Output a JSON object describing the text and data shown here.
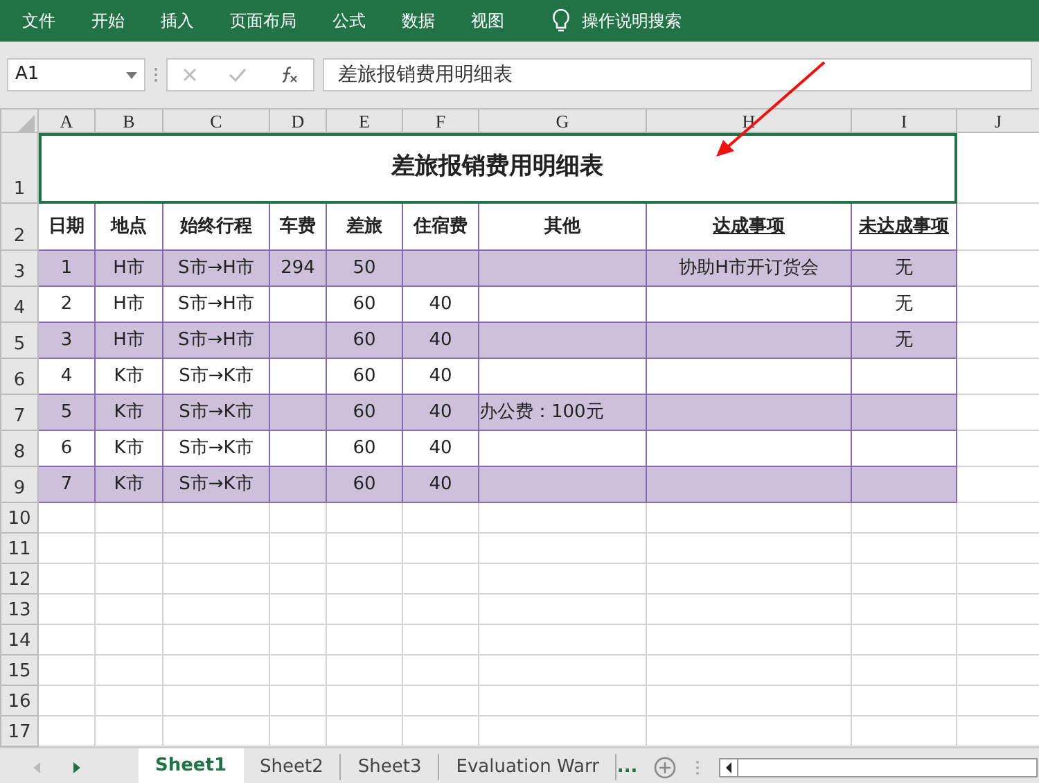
{
  "ribbon_tabs": [
    "文件",
    "开始",
    "插入",
    "页面布局",
    "公式",
    "数据",
    "视图"
  ],
  "tell_me": "操作说明搜索",
  "name_box": "A1",
  "formula": "差旅报销费用明细表",
  "columns": [
    "A",
    "B",
    "C",
    "D",
    "E",
    "F",
    "G",
    "H",
    "I",
    "J"
  ],
  "title": {
    "text": "差旅报销费用明细表",
    "selected": true
  },
  "headers": [
    {
      "text": "日期",
      "underlined": false
    },
    {
      "text": "地点",
      "underlined": false
    },
    {
      "text": "始终行程",
      "underlined": false
    },
    {
      "text": "车费",
      "underlined": false
    },
    {
      "text": "差旅",
      "underlined": false
    },
    {
      "text": "住宿费",
      "underlined": false
    },
    {
      "text": "其他",
      "underlined": false
    },
    {
      "text": "达成事项",
      "underlined": true
    },
    {
      "text": "未达成事项",
      "underlined": true
    }
  ],
  "rows": [
    {
      "shaded": true,
      "cells": [
        "1",
        "H市",
        "S市→H市",
        "294",
        "50",
        null,
        null,
        "协助H市开订货会",
        "无"
      ]
    },
    {
      "shaded": false,
      "cells": [
        "2",
        "H市",
        "S市→H市",
        null,
        "60",
        "40",
        null,
        null,
        "无"
      ]
    },
    {
      "shaded": true,
      "cells": [
        "3",
        "H市",
        "S市→H市",
        null,
        "60",
        "40",
        null,
        null,
        "无"
      ]
    },
    {
      "shaded": false,
      "cells": [
        "4",
        "K市",
        "S市→K市",
        null,
        "60",
        "40",
        null,
        null,
        null
      ]
    },
    {
      "shaded": true,
      "cells": [
        "5",
        "K市",
        "S市→K市",
        null,
        "60",
        "40",
        "办公费：100元",
        null,
        null
      ]
    },
    {
      "shaded": false,
      "cells": [
        "6",
        "K市",
        "S市→K市",
        null,
        "60",
        "40",
        null,
        null,
        null
      ]
    },
    {
      "shaded": true,
      "cells": [
        "7",
        "K市",
        "S市→K市",
        null,
        "60",
        "40",
        null,
        null,
        null
      ]
    }
  ],
  "row_numbers": [
    "1",
    "2",
    "3",
    "4",
    "5",
    "6",
    "7",
    "8",
    "9",
    "10",
    "11",
    "12",
    "13",
    "14",
    "15",
    "16",
    "17"
  ],
  "sheet_tabs": [
    {
      "label": "Sheet1",
      "selected": true
    },
    {
      "label": "Sheet2",
      "selected": false
    },
    {
      "label": "Sheet3",
      "selected": false
    },
    {
      "label": "Evaluation Warr",
      "selected": false
    }
  ],
  "more_tabs": "..."
}
